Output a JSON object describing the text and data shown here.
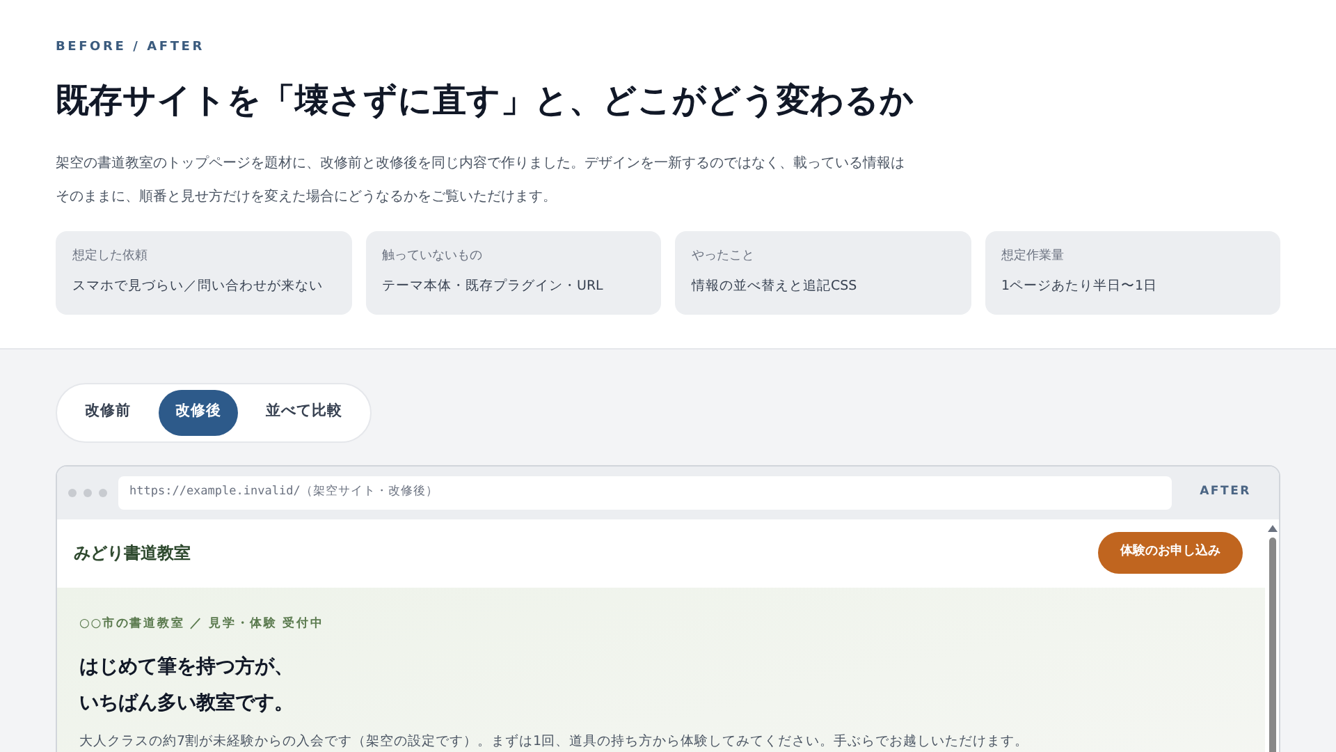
{
  "eyebrow": "BEFORE / AFTER",
  "title": "既存サイトを「壊さずに直す」と、どこがどう変わるか",
  "lead": "架空の書道教室のトップページを題材に、改修前と改修後を同じ内容で作りました。デザインを一新するのではなく、載っている情報はそのままに、順番と見せ方だけを変えた場合にどうなるかをご覧いただけます。",
  "facts": [
    {
      "label": "想定した依頼",
      "value": "スマホで見づらい／問い合わせが来ない"
    },
    {
      "label": "触っていないもの",
      "value": "テーマ本体・既存プラグイン・URL"
    },
    {
      "label": "やったこと",
      "value": "情報の並べ替えと追記CSS"
    },
    {
      "label": "想定作業量",
      "value": "1ページあたり半日〜1日"
    }
  ],
  "tabs": [
    {
      "label": "改修前",
      "selected": false
    },
    {
      "label": "改修後",
      "selected": true
    },
    {
      "label": "並べて比較",
      "selected": false
    }
  ],
  "browser": {
    "url": "https://example.invalid/（架空サイト・改修後）",
    "badge": "AFTER"
  },
  "site": {
    "name": "みどり書道教室",
    "cta": "体験のお申し込み",
    "eyebrow": "○○市の書道教室 ／ 見学・体験 受付中",
    "headline": [
      "はじめて筆を持つ方が、",
      "いちばん多い教室です。"
    ],
    "body": "大人クラスの約7割が未経験からの入会です（架空の設定です）。まずは1回、道具の持ち方から体験してみてください。手ぶらでお越しいただけます。"
  }
}
